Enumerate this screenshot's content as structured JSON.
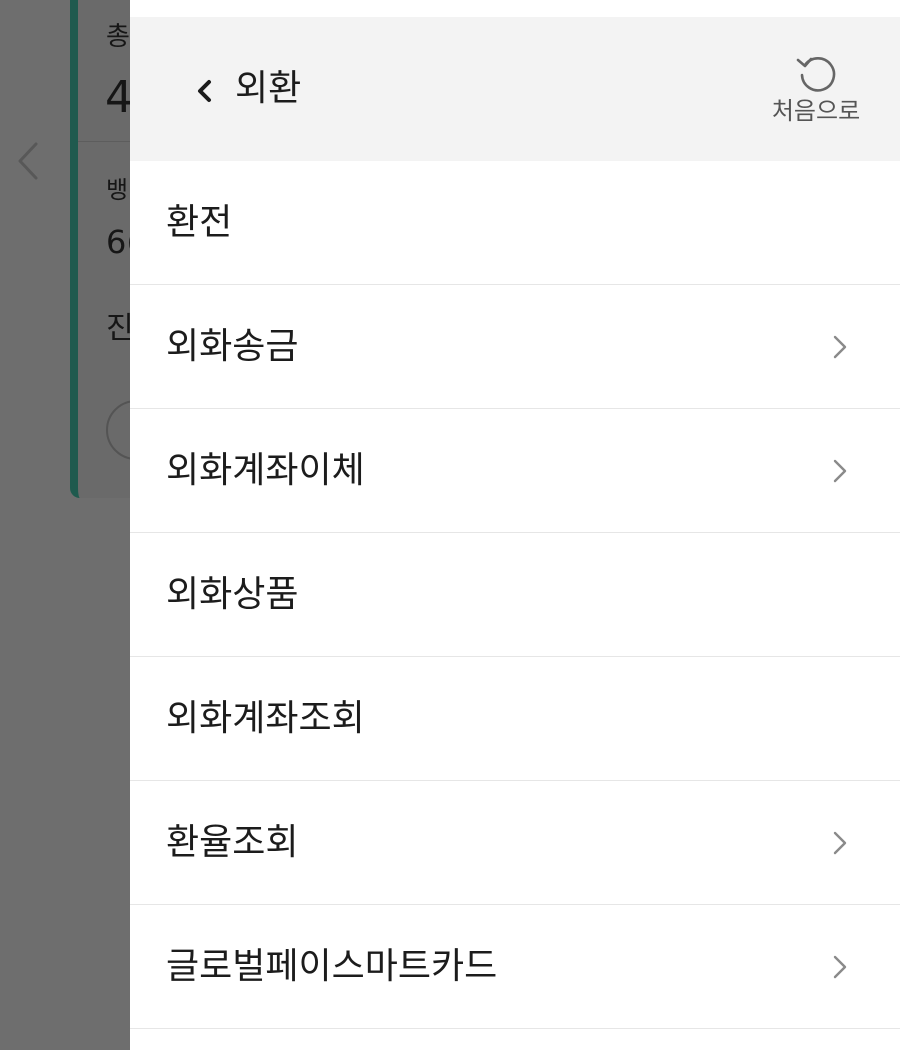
{
  "background_page": {
    "texts": [
      "총",
      "4",
      "뱅",
      "6(",
      "진"
    ]
  },
  "side_menu": {
    "header": {
      "title": "외환",
      "back_icon": "chevron-left-icon",
      "home_button": {
        "label": "처음으로",
        "icon": "refresh-icon"
      }
    },
    "items": [
      {
        "label": "환전",
        "has_submenu": false
      },
      {
        "label": "외화송금",
        "has_submenu": true
      },
      {
        "label": "외화계좌이체",
        "has_submenu": true
      },
      {
        "label": "외화상품",
        "has_submenu": false
      },
      {
        "label": "외화계좌조회",
        "has_submenu": false
      },
      {
        "label": "환율조회",
        "has_submenu": true
      },
      {
        "label": "글로벌페이스마트카드",
        "has_submenu": true
      }
    ]
  },
  "colors": {
    "overlay": "#6e6e6e",
    "panel_background": "#ffffff",
    "header_background": "#f3f3f3",
    "accent_green": "#1f5a4e",
    "text": "#1c1c1c",
    "muted_text": "#555555",
    "chevron": "#8a8a8a"
  }
}
